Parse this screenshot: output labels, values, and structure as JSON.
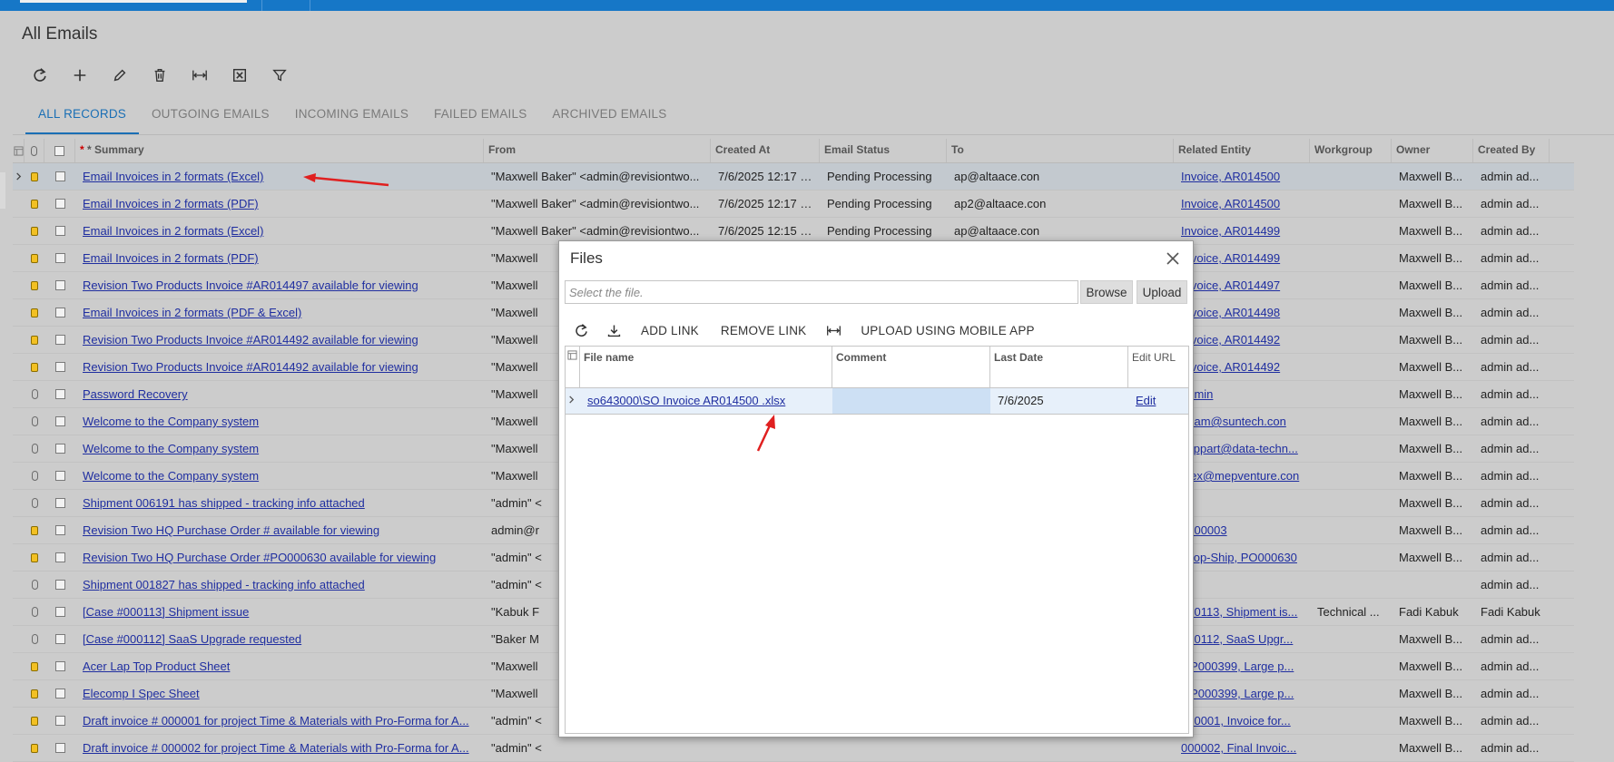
{
  "page": {
    "title": "All Emails"
  },
  "toolbar": {
    "icons": [
      "refresh-icon",
      "add-icon",
      "edit-icon",
      "delete-icon",
      "fit-width-icon",
      "excel-export-icon",
      "filter-icon"
    ]
  },
  "tabs": [
    "ALL RECORDS",
    "OUTGOING EMAILS",
    "INCOMING EMAILS",
    "FAILED EMAILS",
    "ARCHIVED EMAILS"
  ],
  "grid": {
    "columns": [
      "* Summary",
      "From",
      "Created At",
      "Email Status",
      "To",
      "Related Entity",
      "Workgroup",
      "Owner",
      "Created By"
    ],
    "rows": [
      {
        "summary": "Email Invoices in 2 formats (Excel)",
        "from": "\"Maxwell Baker\" <admin@revisiontwo...",
        "created": "7/6/2025 12:17 PM",
        "status": "Pending Processing",
        "to": "ap@altaace.con",
        "entity": "Invoice, AR014500",
        "workgroup": "",
        "owner": "Maxwell B...",
        "createdby": "admin ad...",
        "icon": "package"
      },
      {
        "summary": "Email Invoices in 2 formats (PDF)",
        "from": "\"Maxwell Baker\" <admin@revisiontwo...",
        "created": "7/6/2025 12:17 PM",
        "status": "Pending Processing",
        "to": "ap2@altaace.con",
        "entity": "Invoice, AR014500",
        "workgroup": "",
        "owner": "Maxwell B...",
        "createdby": "admin ad...",
        "icon": "package"
      },
      {
        "summary": "Email Invoices in 2 formats (Excel)",
        "from": "\"Maxwell Baker\" <admin@revisiontwo...",
        "created": "7/6/2025 12:15 PM",
        "status": "Pending Processing",
        "to": "ap@altaace.con",
        "entity": "Invoice, AR014499",
        "workgroup": "",
        "owner": "Maxwell B...",
        "createdby": "admin ad...",
        "icon": "package"
      },
      {
        "summary": "Email Invoices in 2 formats (PDF)",
        "from": "\"Maxwell",
        "created": "",
        "status": "",
        "to": "",
        "entity": "Invoice, AR014499",
        "workgroup": "",
        "owner": "Maxwell B...",
        "createdby": "admin ad...",
        "icon": "package"
      },
      {
        "summary": "Revision Two Products Invoice #AR014497 available for viewing",
        "from": "\"Maxwell",
        "created": "",
        "status": "",
        "to": "",
        "entity": "Invoice, AR014497",
        "workgroup": "",
        "owner": "Maxwell B...",
        "createdby": "admin ad...",
        "icon": "package"
      },
      {
        "summary": "Email Invoices in 2 formats (PDF & Excel)",
        "from": "\"Maxwell",
        "created": "",
        "status": "",
        "to": "",
        "entity": "Invoice, AR014498",
        "workgroup": "",
        "owner": "Maxwell B...",
        "createdby": "admin ad...",
        "icon": "package"
      },
      {
        "summary": "Revision Two Products Invoice #AR014492 available for viewing",
        "from": "\"Maxwell",
        "created": "",
        "status": "",
        "to": "",
        "entity": "Invoice, AR014492",
        "workgroup": "",
        "owner": "Maxwell B...",
        "createdby": "admin ad...",
        "icon": "package"
      },
      {
        "summary": "Revision Two Products Invoice #AR014492 available for viewing",
        "from": "\"Maxwell",
        "created": "",
        "status": "",
        "to": "",
        "entity": "Invoice, AR014492",
        "workgroup": "",
        "owner": "Maxwell B...",
        "createdby": "admin ad...",
        "icon": "package"
      },
      {
        "summary": "Password Recovery",
        "from": "\"Maxwell",
        "created": "",
        "status": "",
        "to": "",
        "entity": "admin",
        "workgroup": "",
        "owner": "Maxwell B...",
        "createdby": "admin ad...",
        "icon": "clip"
      },
      {
        "summary": "Welcome to the Company system",
        "from": "\"Maxwell",
        "created": "",
        "status": "",
        "to": "",
        "entity": "adam@suntech.con",
        "workgroup": "",
        "owner": "Maxwell B...",
        "createdby": "admin ad...",
        "icon": "clip"
      },
      {
        "summary": "Welcome to the Company system",
        "from": "\"Maxwell",
        "created": "",
        "status": "",
        "to": "",
        "entity": "suppart@data-techn...",
        "workgroup": "",
        "owner": "Maxwell B...",
        "createdby": "admin ad...",
        "icon": "clip"
      },
      {
        "summary": "Welcome to the Company system",
        "from": "\"Maxwell",
        "created": "",
        "status": "",
        "to": "",
        "entity": "alex@mepventure.con",
        "workgroup": "",
        "owner": "Maxwell B...",
        "createdby": "admin ad...",
        "icon": "clip"
      },
      {
        "summary": "Shipment 006191 has shipped - tracking info attached",
        "from": "\"admin\" <",
        "created": "",
        "status": "",
        "to": "",
        "entity": "",
        "workgroup": "",
        "owner": "Maxwell B...",
        "createdby": "admin ad...",
        "icon": "clip"
      },
      {
        "summary": "Revision Two HQ Purchase Order # available for viewing",
        "from": "admin@r",
        "created": "",
        "status": "",
        "to": "",
        "entity": "0000003",
        "workgroup": "",
        "owner": "Maxwell B...",
        "createdby": "admin ad...",
        "icon": "package"
      },
      {
        "summary": "Revision Two HQ Purchase Order #PO000630 available for viewing",
        "from": "\"admin\" <",
        "created": "",
        "status": "",
        "to": "",
        "entity": "Drop-Ship, PO000630",
        "workgroup": "",
        "owner": "Maxwell B...",
        "createdby": "admin ad...",
        "icon": "package"
      },
      {
        "summary": "Shipment 001827 has shipped - tracking info attached",
        "from": "\"admin\" <",
        "created": "",
        "status": "",
        "to": "",
        "entity": "",
        "workgroup": "",
        "owner": "",
        "createdby": "admin ad...",
        "icon": "clip"
      },
      {
        "summary": "[Case #000113] Shipment issue",
        "from": "\"Kabuk F",
        "created": "",
        "status": "",
        "to": "",
        "entity": "000113, Shipment is...",
        "workgroup": "Technical ...",
        "owner": "Fadi Kabuk",
        "createdby": "Fadi Kabuk",
        "icon": "clip"
      },
      {
        "summary": "[Case #000112] SaaS Upgrade requested",
        "from": "\"Baker M",
        "created": "",
        "status": "",
        "to": "",
        "entity": "000112, SaaS Upgr...",
        "workgroup": "",
        "owner": "Maxwell B...",
        "createdby": "admin ad...",
        "icon": "clip"
      },
      {
        "summary": "Acer Lap Top Product Sheet",
        "from": "\"Maxwell",
        "created": "",
        "status": "",
        "to": "",
        "entity": "OP000399, Large p...",
        "workgroup": "",
        "owner": "Maxwell B...",
        "createdby": "admin ad...",
        "icon": "package"
      },
      {
        "summary": "Elecomp I Spec Sheet",
        "from": "\"Maxwell",
        "created": "",
        "status": "",
        "to": "",
        "entity": "OP000399, Large p...",
        "workgroup": "",
        "owner": "Maxwell B...",
        "createdby": "admin ad...",
        "icon": "package"
      },
      {
        "summary": "Draft invoice # 000001 for project Time & Materials with Pro-Forma for A...",
        "from": "\"admin\" <",
        "created": "",
        "status": "",
        "to": "",
        "entity": "000001, Invoice for...",
        "workgroup": "",
        "owner": "Maxwell B...",
        "createdby": "admin ad...",
        "icon": "package"
      },
      {
        "summary": "Draft invoice # 000002 for project Time & Materials with Pro-Forma for A...",
        "from": "\"admin\" <",
        "created": "",
        "status": "",
        "to": "",
        "entity": "000002, Final Invoic...",
        "workgroup": "",
        "owner": "Maxwell B...",
        "createdby": "admin ad...",
        "icon": "package"
      }
    ]
  },
  "dialog": {
    "title": "Files",
    "file_placeholder": "Select the file.",
    "browse_label": "Browse",
    "upload_label": "Upload",
    "toolbar": {
      "add_link": "ADD LINK",
      "remove_link": "REMOVE LINK",
      "upload_mobile": "UPLOAD USING MOBILE APP"
    },
    "columns": {
      "file_name": "File name",
      "comment": "Comment",
      "last_date": "Last Date",
      "edit_url": "Edit URL"
    },
    "row": {
      "file_name": "so643000\\SO Invoice AR014500 .xlsx",
      "comment": "",
      "last_date": "7/6/2025",
      "edit": "Edit"
    }
  },
  "colors": {
    "accent": "#1677c7",
    "link": "#1f2ea0",
    "annotation_arrow": "#e02020"
  }
}
